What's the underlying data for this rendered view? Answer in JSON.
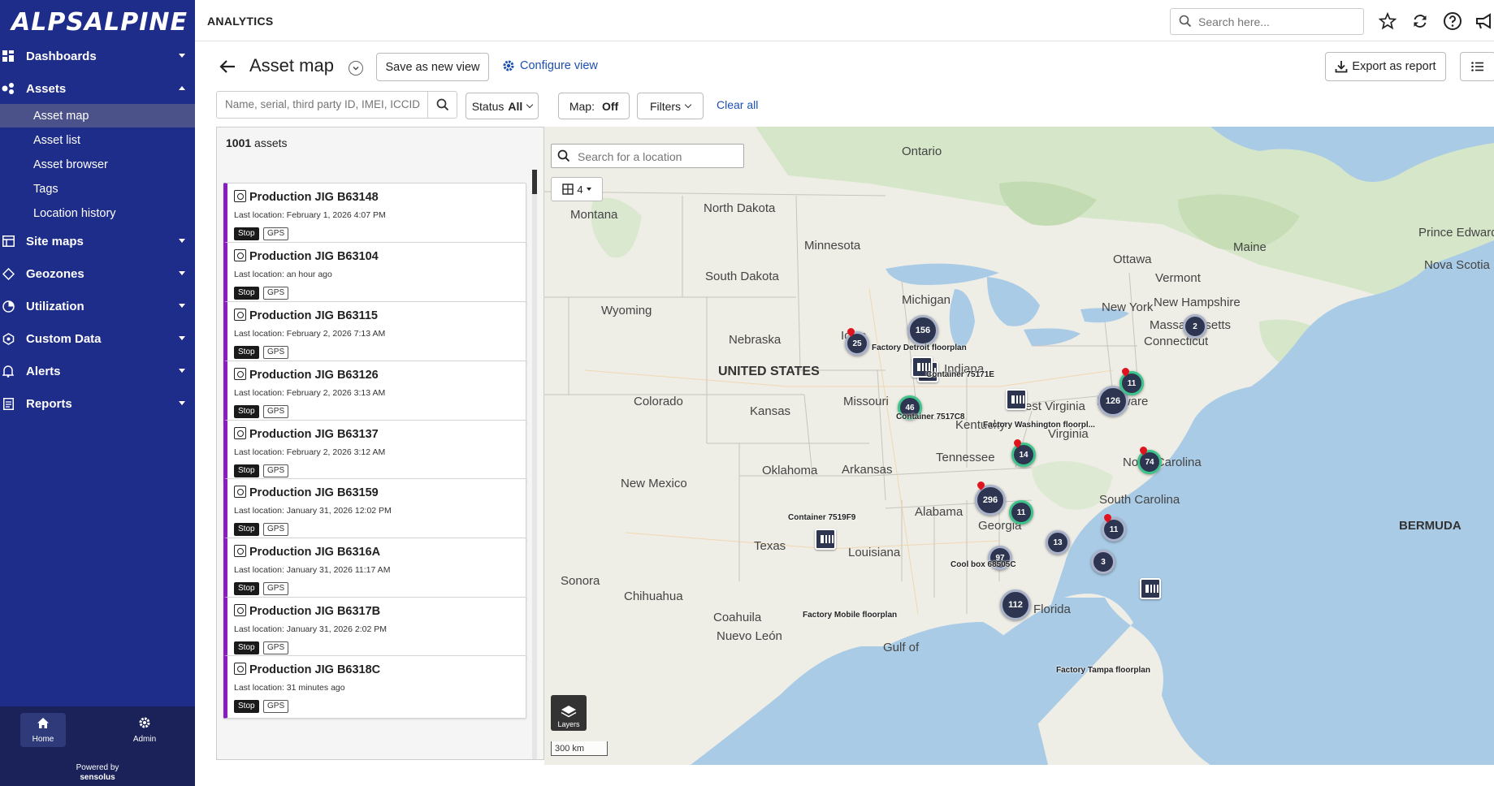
{
  "brand": {
    "logo_text": "ALPSALPINE",
    "powered_line1": "Powered by",
    "powered_line2": "sensolus"
  },
  "header": {
    "section_title": "ANALYTICS",
    "search_placeholder": "Search here..."
  },
  "sidebar": {
    "items": [
      {
        "label": "Dashboards",
        "icon": "grid-icon"
      },
      {
        "label": "Assets",
        "icon": "asset-icon",
        "expanded": true
      },
      {
        "label": "Site maps",
        "icon": "map-icon"
      },
      {
        "label": "Geozones",
        "icon": "geozone-icon"
      },
      {
        "label": "Utilization",
        "icon": "pie-icon"
      },
      {
        "label": "Custom Data",
        "icon": "custom-data-icon"
      },
      {
        "label": "Alerts",
        "icon": "bell-icon"
      },
      {
        "label": "Reports",
        "icon": "report-icon"
      }
    ],
    "asset_subitems": [
      "Asset map",
      "Asset list",
      "Asset browser",
      "Tags",
      "Location history"
    ],
    "active_subitem": "Asset map",
    "home_label": "Home",
    "admin_label": "Admin"
  },
  "page": {
    "title": "Asset map",
    "save_view_label": "Save as new view",
    "configure_view_label": "Configure view",
    "export_label": "Export as report"
  },
  "filters": {
    "search_placeholder": "Name, serial, third party ID, IMEI, ICCID",
    "status_label": "Status",
    "status_value": "All",
    "map_label": "Map:",
    "map_value": "Off",
    "filters_label": "Filters",
    "clear_all_label": "Clear all"
  },
  "asset_list": {
    "count": "1001",
    "count_suffix": "assets",
    "items": [
      {
        "name": "Production JIG B63148",
        "location": "Last location: February 1, 2026 4:07 PM",
        "status": "Stop",
        "source": "GPS"
      },
      {
        "name": "Production JIG B63104",
        "location": "Last location: an hour ago",
        "status": "Stop",
        "source": "GPS"
      },
      {
        "name": "Production JIG B63115",
        "location": "Last location: February 2, 2026 7:13 AM",
        "status": "Stop",
        "source": "GPS"
      },
      {
        "name": "Production JIG B63126",
        "location": "Last location: February 2, 2026 3:13 AM",
        "status": "Stop",
        "source": "GPS"
      },
      {
        "name": "Production JIG B63137",
        "location": "Last location: February 2, 2026 3:12 AM",
        "status": "Stop",
        "source": "GPS"
      },
      {
        "name": "Production JIG B63159",
        "location": "Last location: January 31, 2026 12:02 PM",
        "status": "Stop",
        "source": "GPS"
      },
      {
        "name": "Production JIG B6316A",
        "location": "Last location: January 31, 2026 11:17 AM",
        "status": "Stop",
        "source": "GPS"
      },
      {
        "name": "Production JIG B6317B",
        "location": "Last location: January 31, 2026 2:02 PM",
        "status": "Stop",
        "source": "GPS"
      },
      {
        "name": "Production JIG B6318C",
        "location": "Last location: 31 minutes ago",
        "status": "Stop",
        "source": "GPS"
      }
    ]
  },
  "map": {
    "location_search_placeholder": "Search for a location",
    "layer_count": "4",
    "layers_label": "Layers",
    "scale_label": "300 km",
    "labels": [
      "Ontario",
      "North Dakota",
      "Montana",
      "Minnesota",
      "South Dakota",
      "Wyoming",
      "Nebraska",
      "Iowa",
      "Michigan",
      "Ottawa",
      "Maine",
      "Vermont",
      "New Hampshire",
      "New York",
      "Massachusetts",
      "Connecticut",
      "Prince Edward Island",
      "Nova Scotia",
      "Indiana",
      "Colorado",
      "Kansas",
      "Missouri",
      "West Virginia",
      "Kentucky",
      "Virginia",
      "Delaware",
      "Tennessee",
      "North Carolina",
      "South Carolina",
      "Arkansas",
      "Oklahoma",
      "New Mexico",
      "Texas",
      "Louisiana",
      "Alabama",
      "Georgia",
      "Florida",
      "Sonora",
      "Chihuahua",
      "Coahuila",
      "Nuevo León",
      "Gulf of",
      "UNITED STATES",
      "BERMUDA"
    ],
    "clusters": [
      "25",
      "156",
      "46",
      "126",
      "11",
      "2",
      "14",
      "74",
      "296",
      "11",
      "13",
      "11",
      "97",
      "3",
      "112"
    ],
    "poi_labels": [
      "Factory Detroit floorplan",
      "Container 75171E",
      "Container 7517C8",
      "Factory Washington floorpl...",
      "Container 7519F9",
      "Cool box 68505C",
      "Factory Mobile floorplan",
      "Factory Tampa floorplan"
    ]
  }
}
